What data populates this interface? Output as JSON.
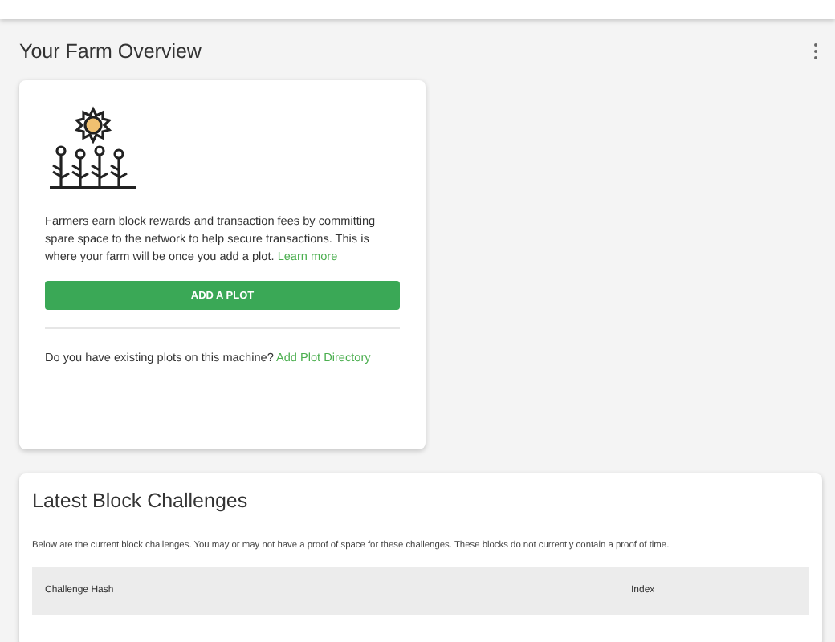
{
  "page_title": "Your Farm Overview",
  "overview_card": {
    "description": "Farmers earn block rewards and transaction fees by committing spare space to the network to help secure transactions. This is where your farm will be once you add a plot.",
    "learn_more_link": "Learn more",
    "add_plot_button": "ADD A PLOT",
    "existing_question": "Do you have existing plots on this machine?",
    "add_directory_link": "Add Plot Directory"
  },
  "challenges": {
    "title": "Latest Block Challenges",
    "description": "Below are the current block challenges. You may or may not have a proof of space for these challenges. These blocks do not currently contain a proof of time.",
    "table": {
      "columns": [
        "Challenge Hash",
        "Index"
      ]
    }
  }
}
